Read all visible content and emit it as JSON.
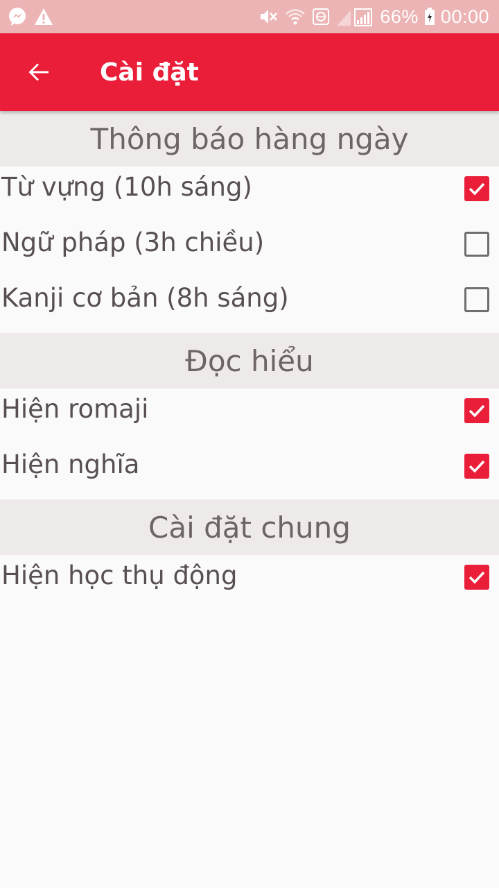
{
  "status_bar": {
    "battery_percent": "66%",
    "time": "00:00",
    "icons": [
      "messenger-icon",
      "warning-icon",
      "mute-icon",
      "wifi-icon",
      "data-icon",
      "signal-icon",
      "battery-icon"
    ]
  },
  "app_bar": {
    "title": "Cài đặt",
    "back_icon": "arrow-back-icon",
    "color": "#eb1e3a"
  },
  "sections": [
    {
      "header": "Thông báo hàng ngày",
      "items": [
        {
          "label": "Từ vựng (10h sáng)",
          "checked": true
        },
        {
          "label": "Ngữ pháp (3h chiều)",
          "checked": false
        },
        {
          "label": "Kanji cơ bản (8h sáng)",
          "checked": false
        }
      ]
    },
    {
      "header": "Đọc hiểu",
      "items": [
        {
          "label": "Hiện romaji",
          "checked": true
        },
        {
          "label": "Hiện nghĩa",
          "checked": true
        }
      ]
    },
    {
      "header": "Cài đặt chung",
      "items": [
        {
          "label": "Hiện học thụ động",
          "checked": true
        }
      ]
    }
  ]
}
